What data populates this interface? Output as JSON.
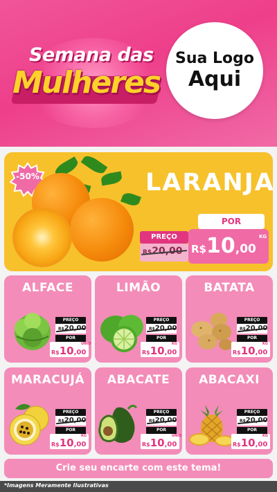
{
  "header": {
    "title_line1": "Semana das",
    "title_line2": "Mulheres",
    "logo_line1": "Sua Logo",
    "logo_line2": "Aqui"
  },
  "featured": {
    "discount_badge": "-50%",
    "name": "LARANJA",
    "preco_label": "PREÇO",
    "old_currency": "R$",
    "old_price": "20,00",
    "por_label": "POR",
    "currency": "R$",
    "price_int": "10",
    "price_dec": ",00",
    "unit": "KG"
  },
  "products": [
    {
      "name": "ALFACE",
      "preco_label": "PREÇO",
      "old_currency": "R$",
      "old_price": "20,00",
      "por_label": "POR",
      "currency": "R$",
      "price_int": "10",
      "price_dec": ",00",
      "unit": "UNID"
    },
    {
      "name": "LIMÃO",
      "preco_label": "PREÇO",
      "old_currency": "R$",
      "old_price": "20,00",
      "por_label": "POR",
      "currency": "R$",
      "price_int": "10",
      "price_dec": ",00",
      "unit": "KG"
    },
    {
      "name": "BATATA",
      "preco_label": "PREÇO",
      "old_currency": "R$",
      "old_price": "20,00",
      "por_label": "POR",
      "currency": "R$",
      "price_int": "10",
      "price_dec": ",00",
      "unit": "KG"
    },
    {
      "name": "MARACUJÁ",
      "preco_label": "PREÇO",
      "old_currency": "R$",
      "old_price": "20,00",
      "por_label": "POR",
      "currency": "R$",
      "price_int": "10",
      "price_dec": ",00",
      "unit": "KG"
    },
    {
      "name": "ABACATE",
      "preco_label": "PREÇO",
      "old_currency": "R$",
      "old_price": "20,00",
      "por_label": "POR",
      "currency": "R$",
      "price_int": "10",
      "price_dec": ",00",
      "unit": "UNID"
    },
    {
      "name": "ABACAXI",
      "preco_label": "PREÇO",
      "old_currency": "R$",
      "old_price": "20,00",
      "por_label": "POR",
      "currency": "R$",
      "price_int": "10",
      "price_dec": ",00",
      "unit": "KG"
    }
  ],
  "cta": "Crie seu encarte com este tema!",
  "footnote": "*Imagens Meramente Ilustrativas",
  "colors": {
    "header_pink": "#ee3f8a",
    "featured_yellow": "#f7c12b",
    "card_pink": "#f38cb8",
    "price_pink": "#e1367f",
    "title_yellow": "#ffd12a"
  },
  "icons": [
    "orange-illustration",
    "lettuce-illustration",
    "lime-illustration",
    "potato-illustration",
    "passion-fruit-illustration",
    "avocado-illustration",
    "pineapple-illustration",
    "discount-burst-icon"
  ]
}
